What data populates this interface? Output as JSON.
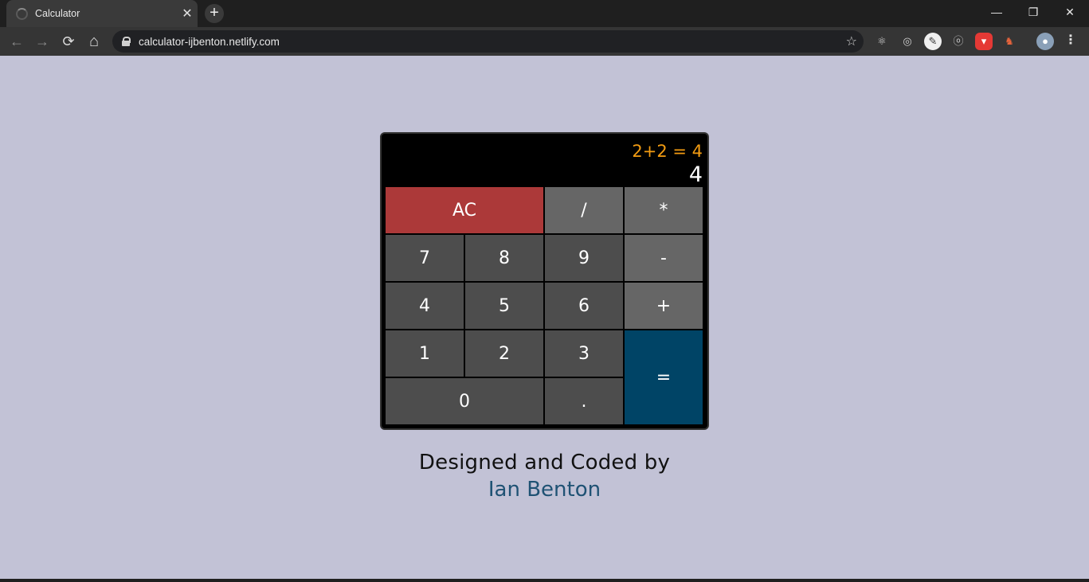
{
  "browser": {
    "tab": {
      "title": "Calculator",
      "close": "✕",
      "icon": "loading-spinner-icon"
    },
    "new_tab": "+",
    "window_controls": {
      "minimize": "—",
      "restore": "❐",
      "close": "✕"
    },
    "nav": {
      "back": "←",
      "forward": "→",
      "reload": "⟳",
      "home": "⌂"
    },
    "url": "calculator-ijbenton.netlify.com",
    "bookmark": "☆",
    "extensions": [
      "react-devtools-icon",
      "target-icon",
      "eyedropper-icon",
      "spy-icon",
      "shield-icon",
      "fox-icon"
    ],
    "menu": "⋮"
  },
  "calculator": {
    "formula": "2+2 = 4",
    "output": "4",
    "keys": {
      "clear": "AC",
      "divide": "/",
      "multiply": "*",
      "seven": "7",
      "eight": "8",
      "nine": "9",
      "subtract": "-",
      "four": "4",
      "five": "5",
      "six": "6",
      "add": "+",
      "one": "1",
      "two": "2",
      "three": "3",
      "equals": "=",
      "zero": "0",
      "decimal": "."
    },
    "colors": {
      "clear": "#ac3939",
      "operator": "#666666",
      "number": "#4d4d4d",
      "equals": "#004466",
      "formula": "#f39c12"
    }
  },
  "credit": {
    "text": "Designed and Coded by",
    "author": "Ian Benton"
  }
}
